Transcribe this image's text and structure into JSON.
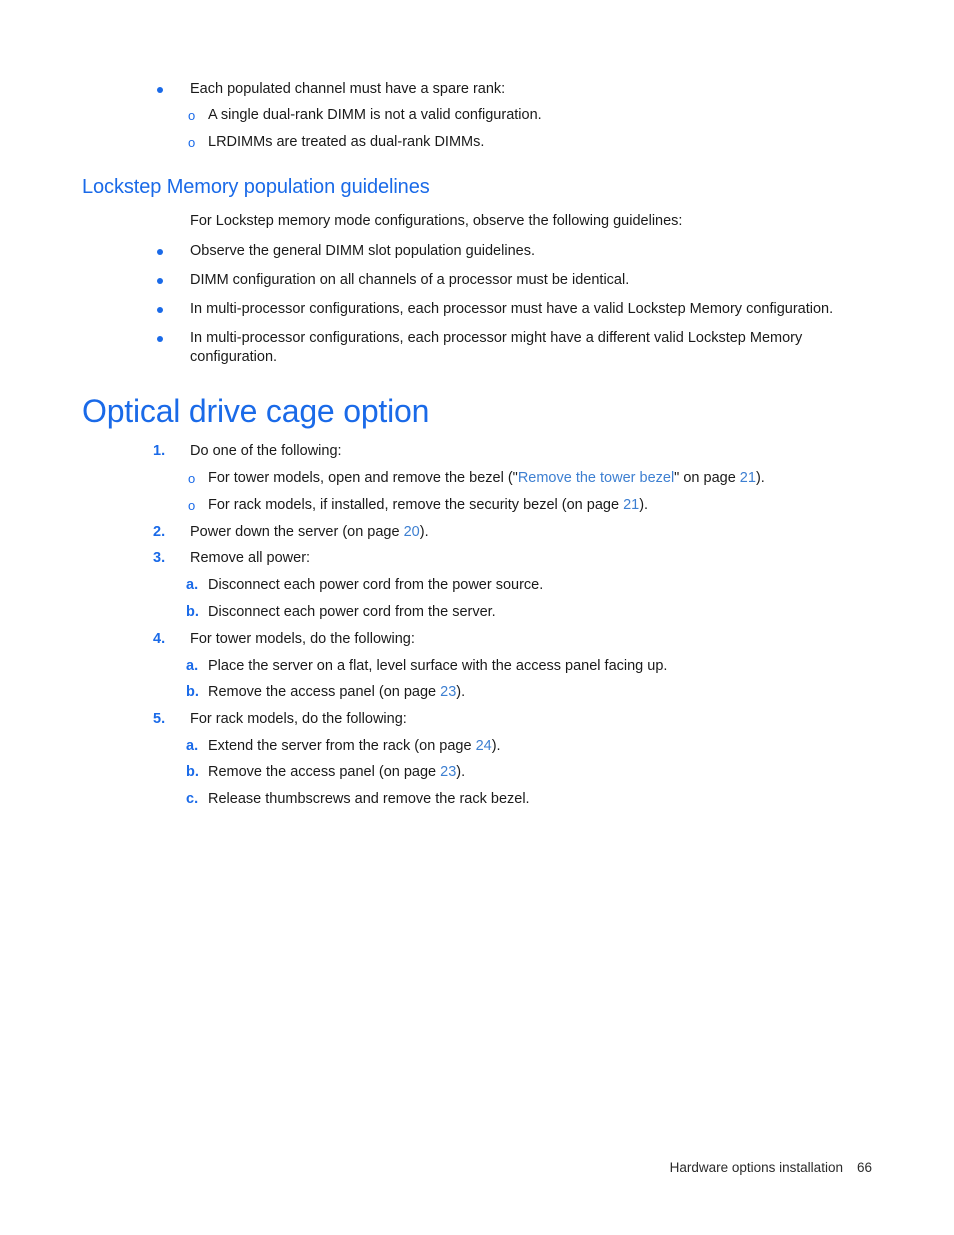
{
  "document": {
    "page_number": "66",
    "footer_label": "Hardware options installation"
  },
  "colors": {
    "heading_blue": "#1a6ae8",
    "link_blue": "#3d7fd1",
    "body_text": "#1a1a1a",
    "page_background": "#ffffff"
  },
  "top_bullets": {
    "lead": "Each populated channel must have a spare rank:",
    "sub": [
      "A single dual-rank DIMM is not a valid configuration.",
      "LRDIMMs are treated as dual-rank DIMMs."
    ]
  },
  "lockstep_section": {
    "heading": "Lockstep Memory population guidelines",
    "intro": "For Lockstep memory mode configurations, observe the following guidelines:",
    "bullets": [
      "Observe the general DIMM slot population guidelines.",
      "DIMM configuration on all channels of a processor must be identical.",
      "In multi-processor configurations, each processor must have a valid Lockstep Memory configuration.",
      "In multi-processor configurations, each processor might have a different valid Lockstep Memory configuration."
    ]
  },
  "optical_section": {
    "heading": "Optical drive cage option",
    "steps": {
      "s1": {
        "marker": "1.",
        "text": "Do one of the following:",
        "sub_a_pre": "For tower models, open and remove the bezel (\"",
        "sub_a_link": "Remove the tower bezel",
        "sub_a_mid": "\" on page ",
        "sub_a_page": "21",
        "sub_a_post": ").",
        "sub_b_pre": "For rack models, if installed, remove the security bezel (on page ",
        "sub_b_page": "21",
        "sub_b_post": ")."
      },
      "s2": {
        "marker": "2.",
        "pre": "Power down the server (on page ",
        "page": "20",
        "post": ")."
      },
      "s3": {
        "marker": "3.",
        "text": "Remove all power:",
        "a_marker": "a.",
        "a_text": "Disconnect each power cord from the power source.",
        "b_marker": "b.",
        "b_text": "Disconnect each power cord from the server."
      },
      "s4": {
        "marker": "4.",
        "text": "For tower models, do the following:",
        "a_marker": "a.",
        "a_text": "Place the server on a flat, level surface with the access panel facing up.",
        "b_marker": "b.",
        "b_pre": "Remove the access panel (on page ",
        "b_page": "23",
        "b_post": ")."
      },
      "s5": {
        "marker": "5.",
        "text": "For rack models, do the following:",
        "a_marker": "a.",
        "a_pre": "Extend the server from the rack (on page ",
        "a_page": "24",
        "a_post": ").",
        "b_marker": "b.",
        "b_pre": "Remove the access panel (on page ",
        "b_page": "23",
        "b_post": ").",
        "c_marker": "c.",
        "c_text": "Release thumbscrews and remove the rack bezel."
      }
    }
  },
  "icons": {
    "bullet_dot": "bullet-dot-icon",
    "bullet_circle": "bullet-circle-icon"
  }
}
